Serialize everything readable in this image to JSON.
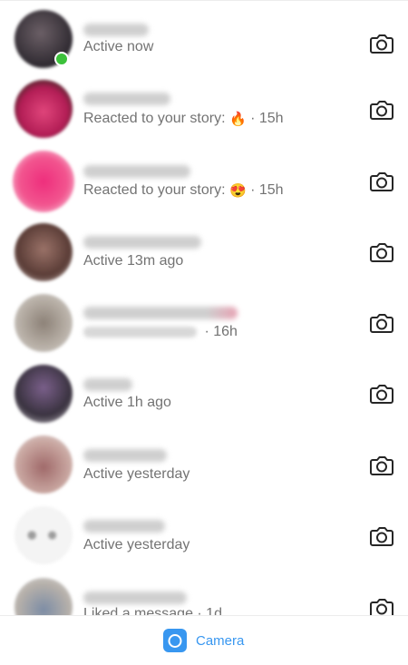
{
  "threads": [
    {
      "status": "Active now",
      "online": true
    },
    {
      "status": "Reacted to your story:",
      "emoji": "🔥",
      "time": "· 15h"
    },
    {
      "status": "Reacted to your story:",
      "emoji": "😍",
      "time": "· 15h"
    },
    {
      "status": "Active 13m ago"
    },
    {
      "status": "",
      "time": "· 16h"
    },
    {
      "status": "Active 1h ago"
    },
    {
      "status": "Active yesterday"
    },
    {
      "status": "Active yesterday"
    },
    {
      "status": "Liked a message · 1d"
    }
  ],
  "tabbar": {
    "camera_label": "Camera",
    "camera_icon": "camera-icon"
  },
  "colors": {
    "accent": "#3897f0",
    "online": "#3cc13b",
    "secondary_text": "#737373"
  }
}
